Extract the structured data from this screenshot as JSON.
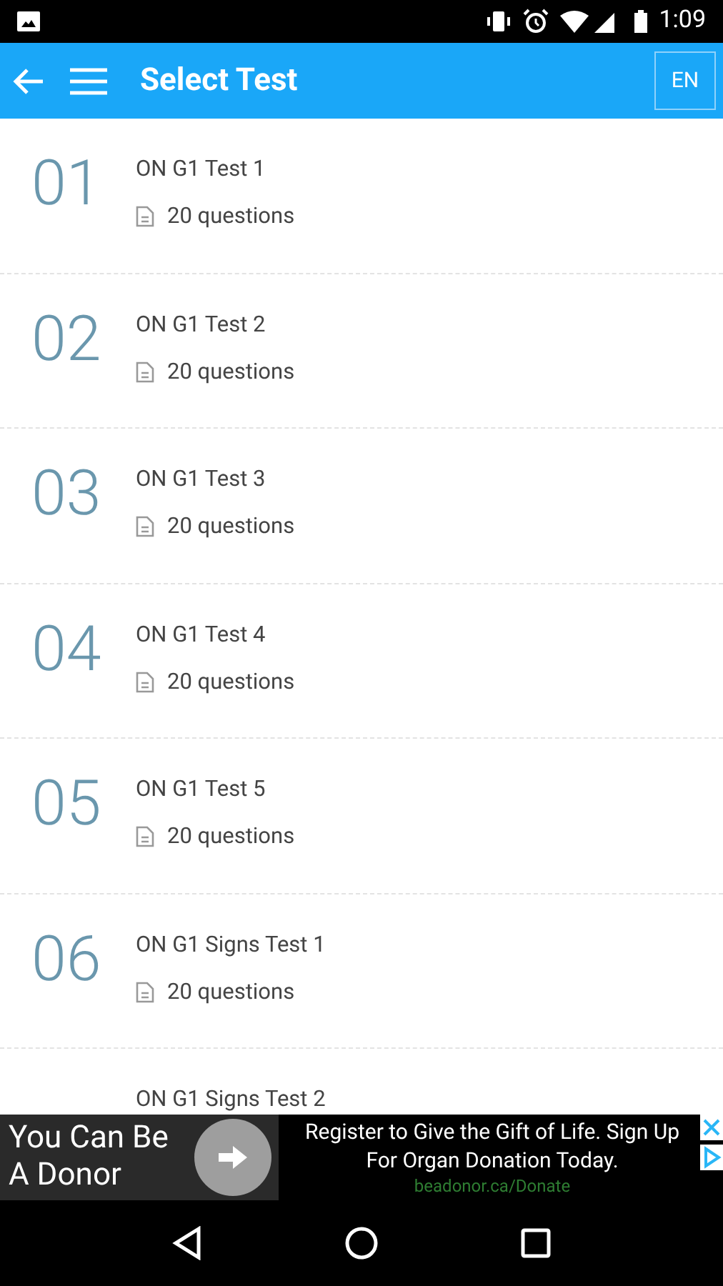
{
  "status_bar": {
    "time": "1:09"
  },
  "app_bar": {
    "title": "Select Test",
    "language_button": "EN"
  },
  "tests": [
    {
      "number": "01",
      "title": "ON G1 Test 1",
      "questions": "20 questions"
    },
    {
      "number": "02",
      "title": "ON G1 Test 2",
      "questions": "20 questions"
    },
    {
      "number": "03",
      "title": "ON G1 Test 3",
      "questions": "20 questions"
    },
    {
      "number": "04",
      "title": "ON G1 Test 4",
      "questions": "20 questions"
    },
    {
      "number": "05",
      "title": "ON G1 Test 5",
      "questions": "20 questions"
    },
    {
      "number": "06",
      "title": "ON G1 Signs Test 1",
      "questions": "20 questions"
    },
    {
      "title": "ON G1 Signs Test 2"
    }
  ],
  "ad": {
    "headline": "You Can Be A Donor",
    "text": "Register to Give the Gift of Life. Sign Up For Organ Donation Today.",
    "url": "beadonor.ca/Donate"
  }
}
